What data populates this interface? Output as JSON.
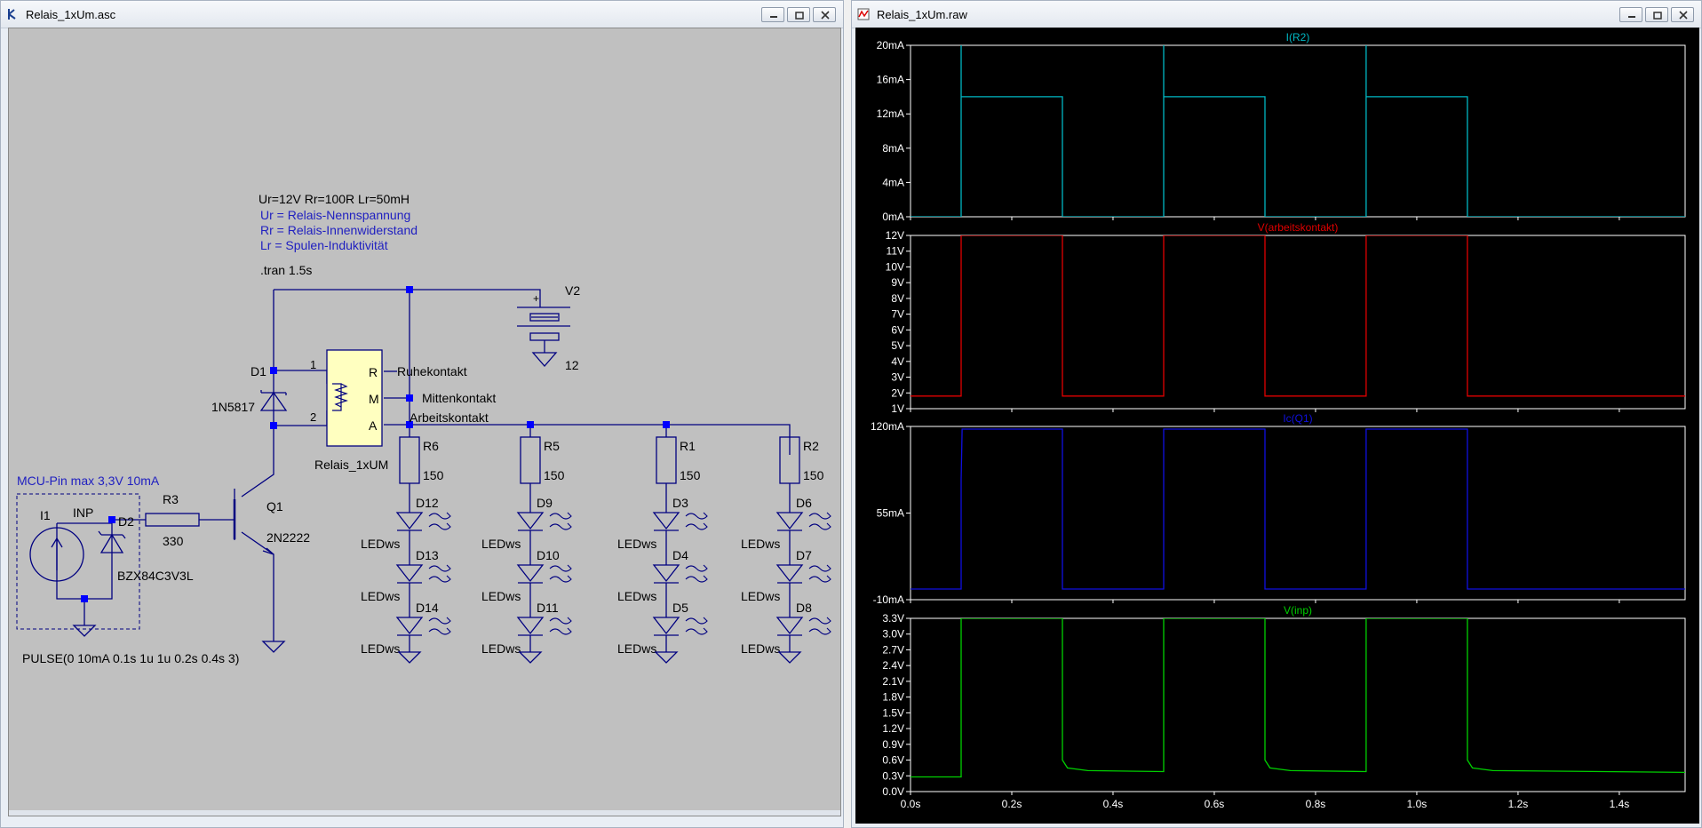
{
  "schematic_window": {
    "title": "Relais_1xUm.asc",
    "params_line": "Ur=12V Rr=100R Lr=50mH",
    "comment_lines": [
      "Ur = Relais-Nennspannung",
      "Rr = Relais-Innenwiderstand",
      "Lr = Spulen-Induktivität"
    ],
    "tran": ".tran 1.5s",
    "v2_label": "V2",
    "v2_value": "12",
    "relay_name": "Relais_1xUM",
    "relay_pin1": "1",
    "relay_pin2": "2",
    "relay_R": "R",
    "relay_M": "M",
    "relay_A": "A",
    "net_ruhe": "Ruhekontakt",
    "net_mitten": "Mittenkontakt",
    "net_arbeit": "Arbeitskontakt",
    "d1_label": "D1",
    "d1_value": "1N5817",
    "q1_label": "Q1",
    "q1_value": "2N2222",
    "r3_label": "R3",
    "r3_value": "330",
    "mcu_note": "MCU-Pin max 3,3V 10mA",
    "i1_label": "I1",
    "inp_label": "INP",
    "d2_label": "D2",
    "d2_value": "BZX84C3V3L",
    "pulse": "PULSE(0 10mA 0.1s 1u 1u 0.2s 0.4s 3)",
    "resistor_value": "150",
    "led_model": "LEDws",
    "branches": [
      {
        "res": "R6",
        "leds": [
          "D12",
          "D13",
          "D14"
        ]
      },
      {
        "res": "R5",
        "leds": [
          "D9",
          "D10",
          "D11"
        ]
      },
      {
        "res": "R1",
        "leds": [
          "D3",
          "D4",
          "D5"
        ]
      },
      {
        "res": "R2",
        "leds": [
          "D6",
          "D7",
          "D8"
        ]
      }
    ]
  },
  "waveform_window": {
    "title": "Relais_1xUm.raw",
    "x_ticks": [
      "0.0s",
      "0.2s",
      "0.4s",
      "0.6s",
      "0.8s",
      "1.0s",
      "1.2s",
      "1.4s"
    ],
    "colors": {
      "irr2": "#00b7c3",
      "varbeit": "#e00000",
      "icq1": "#1010e0",
      "vinp": "#00d000",
      "grid": "#ffffff",
      "bg": "#000000"
    }
  },
  "chart_data": [
    {
      "type": "line",
      "title": "I(R2)",
      "ylim": [
        0,
        20
      ],
      "yticks": [
        "0mA",
        "4mA",
        "8mA",
        "12mA",
        "16mA",
        "20mA"
      ],
      "series": [
        {
          "name": "I(R2)",
          "x": [
            0,
            0.1,
            0.1,
            0.1,
            0.3,
            0.3,
            0.5,
            0.5,
            0.5,
            0.7,
            0.7,
            0.9,
            0.9,
            0.9,
            1.1,
            1.1,
            1.6
          ],
          "y": [
            0,
            0,
            20,
            14,
            14,
            0,
            0,
            20,
            14,
            14,
            0,
            0,
            20,
            14,
            14,
            0,
            0
          ]
        }
      ]
    },
    {
      "type": "line",
      "title": "V(arbeitskontakt)",
      "ylim": [
        1,
        12
      ],
      "yticks": [
        "1V",
        "2V",
        "3V",
        "4V",
        "5V",
        "6V",
        "7V",
        "8V",
        "9V",
        "10V",
        "11V",
        "12V"
      ],
      "series": [
        {
          "name": "V(arbeitskontakt)",
          "x": [
            0,
            0.1,
            0.1,
            0.3,
            0.3,
            0.5,
            0.5,
            0.7,
            0.7,
            0.9,
            0.9,
            1.1,
            1.1,
            1.6
          ],
          "y": [
            1.8,
            1.8,
            12,
            12,
            1.8,
            1.8,
            12,
            12,
            1.8,
            1.8,
            12,
            12,
            1.8,
            1.8
          ]
        }
      ]
    },
    {
      "type": "line",
      "title": "Ic(Q1)",
      "ylim": [
        -10,
        120
      ],
      "yticks": [
        "-10mA",
        "55mA",
        "120mA"
      ],
      "series": [
        {
          "name": "Ic(Q1)",
          "x": [
            0,
            0.1,
            0.1,
            0.102,
            0.3,
            0.3,
            0.5,
            0.5,
            0.7,
            0.7,
            0.9,
            0.9,
            1.1,
            1.1,
            1.6
          ],
          "y": [
            -2,
            -2,
            80,
            118,
            118,
            -2,
            -2,
            118,
            118,
            -2,
            -2,
            118,
            118,
            -2,
            -2
          ]
        }
      ]
    },
    {
      "type": "line",
      "title": "V(inp)",
      "ylim": [
        0,
        3.3
      ],
      "yticks": [
        "0.0V",
        "0.3V",
        "0.6V",
        "0.9V",
        "1.2V",
        "1.5V",
        "1.8V",
        "2.1V",
        "2.4V",
        "2.7V",
        "3.0V",
        "3.3V"
      ],
      "series": [
        {
          "name": "V(inp)",
          "x": [
            0,
            0.1,
            0.1,
            0.3,
            0.3,
            0.31,
            0.35,
            0.5,
            0.5,
            0.7,
            0.7,
            0.71,
            0.75,
            0.9,
            0.9,
            1.1,
            1.1,
            1.11,
            1.15,
            1.6
          ],
          "y": [
            0.28,
            0.28,
            3.3,
            3.3,
            0.6,
            0.45,
            0.4,
            0.38,
            3.3,
            3.3,
            0.6,
            0.45,
            0.4,
            0.38,
            3.3,
            3.3,
            0.6,
            0.45,
            0.4,
            0.36
          ]
        }
      ]
    }
  ]
}
